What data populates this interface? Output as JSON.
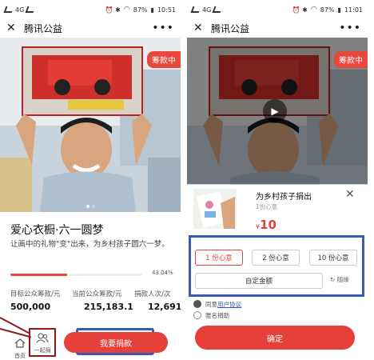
{
  "left": {
    "status": {
      "carrier_text": "4G",
      "icons": "⏰ ✱",
      "battery": "87%",
      "time": "10:51"
    },
    "navbar": {
      "close_icon": "✕",
      "title": "腾讯公益",
      "more_icon": "•••"
    },
    "badge": "筹款中",
    "project": {
      "title": "爱心衣橱·六一圆梦",
      "description": "让画中的礼物\"变\"出来，为乡村孩子圆六一梦。",
      "progress_percent": 43.04,
      "progress_label": "43.04%"
    },
    "stats": [
      {
        "label": "目标公众筹款/元",
        "value": "500,000"
      },
      {
        "label": "当前公众筹款/元",
        "value": "215,183.1"
      },
      {
        "label": "捐款人次/次",
        "value": "12,691"
      }
    ],
    "bottom": {
      "home_label": "首页",
      "together_label": "一起捐",
      "donate_label": "我要捐款"
    },
    "colors": {
      "accent": "#e5413a",
      "highlight": "#3a5bb5",
      "annotation": "#8b1a1a"
    }
  },
  "right": {
    "status": {
      "carrier_text": "4G",
      "icons": "⏰ ✱",
      "battery": "87%",
      "time": "11:01"
    },
    "navbar": {
      "close_icon": "✕",
      "title": "腾讯公益",
      "more_icon": "•••"
    },
    "badge": "筹款中",
    "sheet": {
      "project_name": "为乡村孩子捐出",
      "project_sub": "1份心意",
      "currency": "¥",
      "price": "10",
      "options": [
        "1 份心意",
        "2 份心意",
        "10 份心意"
      ],
      "selected_option": 0,
      "custom_label": "自定金额",
      "random_label": "随缘",
      "agree_prefix": "同意",
      "agree_link": "用户协议",
      "anonymous_label": "匿名捐助",
      "confirm_label": "确定"
    }
  }
}
